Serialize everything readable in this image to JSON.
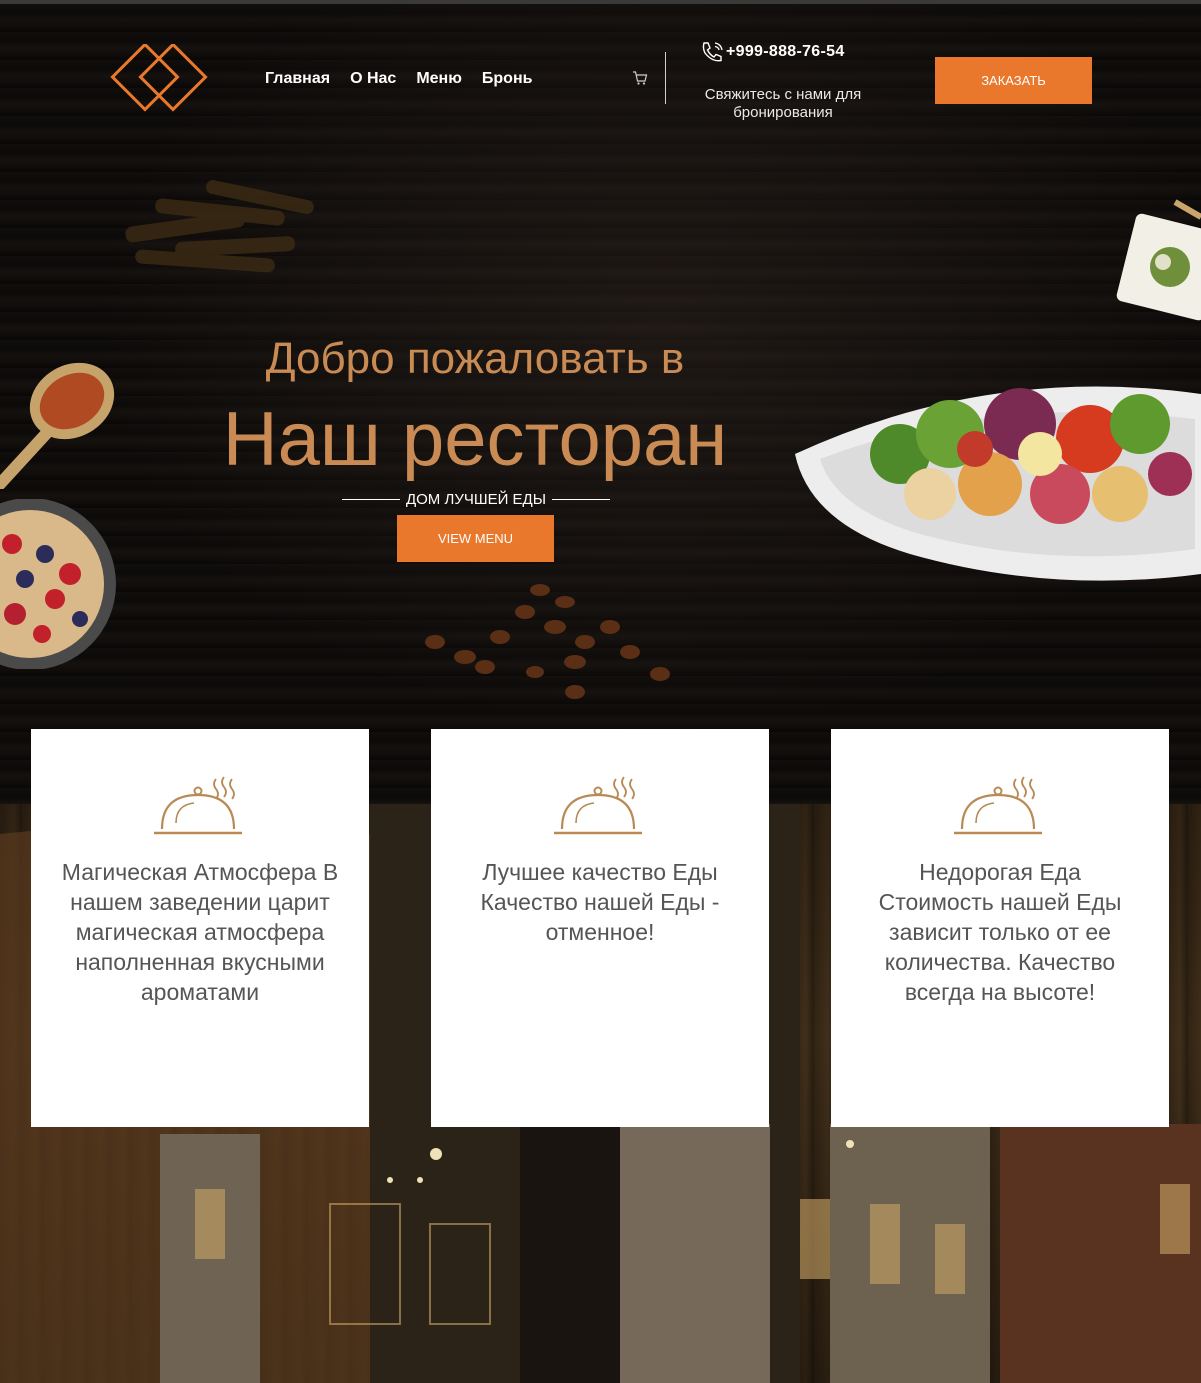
{
  "header": {
    "nav": [
      "Главная",
      "О Нас",
      "Меню",
      "Бронь"
    ],
    "phone": "+999-888-76-54",
    "contact_text": "Свяжитесь с нами для бронирования",
    "order_button": "ЗАКАЗАТЬ"
  },
  "hero": {
    "subtitle": "Добро пожаловать в",
    "title": "Наш ресторан",
    "tagline": "ДОМ ЛУЧШЕЙ ЕДЫ",
    "button": "VIEW MENU"
  },
  "features": [
    {
      "text": "Магическая Атмосфера В нашем заведении царит магическая атмосфера наполненная вкусными ароматами"
    },
    {
      "text": "Лучшее качество Еды Качество нашей Еды - отменное!"
    },
    {
      "text": "Недорогая Еда Стоимость нашей Еды зависит только от ее количества. Качество всегда на высоте!"
    }
  ],
  "colors": {
    "accent": "#e9782c",
    "gold": "#c98b53",
    "icon": "#b98a55"
  },
  "icons": [
    "logo-icon",
    "cart-icon",
    "phone-icon",
    "cloche-icon"
  ]
}
